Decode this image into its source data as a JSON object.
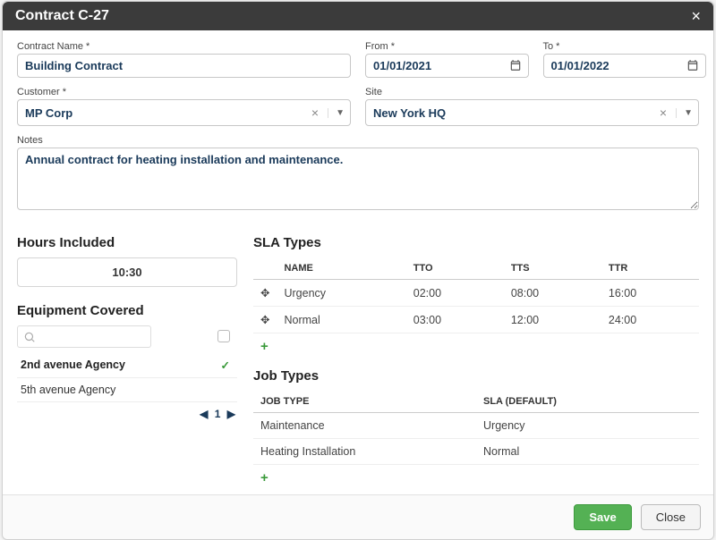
{
  "header": {
    "title": "Contract C-27"
  },
  "form": {
    "contract_name_label": "Contract Name *",
    "contract_name": "Building Contract",
    "from_label": "From *",
    "from": "01/01/2021",
    "to_label": "To *",
    "to": "01/01/2022",
    "customer_label": "Customer *",
    "customer": "MP Corp",
    "site_label": "Site",
    "site": "New York HQ",
    "notes_label": "Notes",
    "notes": "Annual contract for heating installation and maintenance."
  },
  "hours": {
    "title": "Hours Included",
    "value": "10:30"
  },
  "equipment": {
    "title": "Equipment Covered",
    "items": [
      {
        "name": "2nd avenue Agency",
        "selected": true
      },
      {
        "name": "5th avenue Agency",
        "selected": false
      }
    ],
    "page": "1"
  },
  "sla": {
    "title": "SLA Types",
    "cols": {
      "name": "NAME",
      "tto": "TTO",
      "tts": "TTS",
      "ttr": "TTR"
    },
    "rows": [
      {
        "name": "Urgency",
        "tto": "02:00",
        "tts": "08:00",
        "ttr": "16:00"
      },
      {
        "name": "Normal",
        "tto": "03:00",
        "tts": "12:00",
        "ttr": "24:00"
      }
    ]
  },
  "jobtypes": {
    "title": "Job Types",
    "cols": {
      "jobtype": "JOB TYPE",
      "sla": "SLA (DEFAULT)"
    },
    "rows": [
      {
        "jobtype": "Maintenance",
        "sla": "Urgency"
      },
      {
        "jobtype": "Heating Installation",
        "sla": "Normal"
      }
    ]
  },
  "footer": {
    "save": "Save",
    "close": "Close"
  }
}
